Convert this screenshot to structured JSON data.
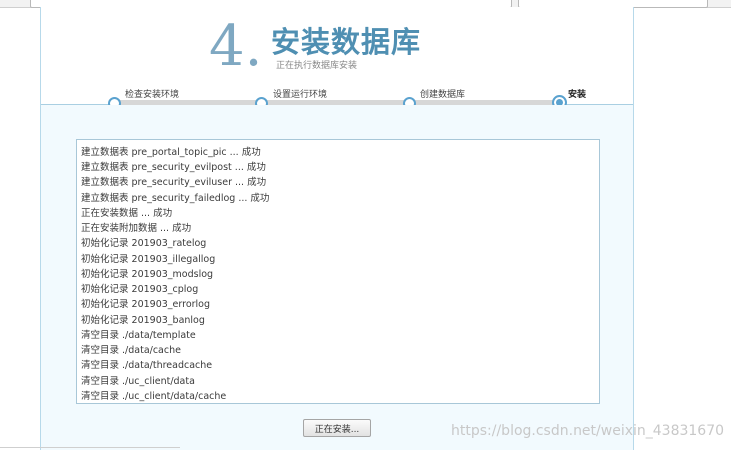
{
  "header": {
    "step_number": "4.",
    "title": "安装数据库",
    "subtitle": "正在执行数据库安装"
  },
  "steps": [
    {
      "label": "检查安装环境"
    },
    {
      "label": "设置运行环境"
    },
    {
      "label": "创建数据库"
    },
    {
      "label": "安装",
      "current": true
    }
  ],
  "log": {
    "lines": [
      "建立数据表 pre_portal_topic_pic ... 成功",
      "建立数据表 pre_security_evilpost ... 成功",
      "建立数据表 pre_security_eviluser ... 成功",
      "建立数据表 pre_security_failedlog ... 成功",
      "正在安装数据 ... 成功",
      "正在安装附加数据 ... 成功",
      "初始化记录 201903_ratelog",
      "初始化记录 201903_illegallog",
      "初始化记录 201903_modslog",
      "初始化记录 201903_cplog",
      "初始化记录 201903_errorlog",
      "初始化记录 201903_banlog",
      "清空目录 ./data/template",
      "清空目录 ./data/cache",
      "清空目录 ./data/threadcache",
      "清空目录 ./uc_client/data",
      "清空目录 ./uc_client/data/cache"
    ]
  },
  "button": {
    "label": "正在安装..."
  },
  "watermark": "https://blog.csdn.net/weixin_43831670",
  "colors": {
    "accent": "#4f8fb2",
    "progress_dot": "#5aa2cf",
    "content_bg": "#f2fafe"
  }
}
